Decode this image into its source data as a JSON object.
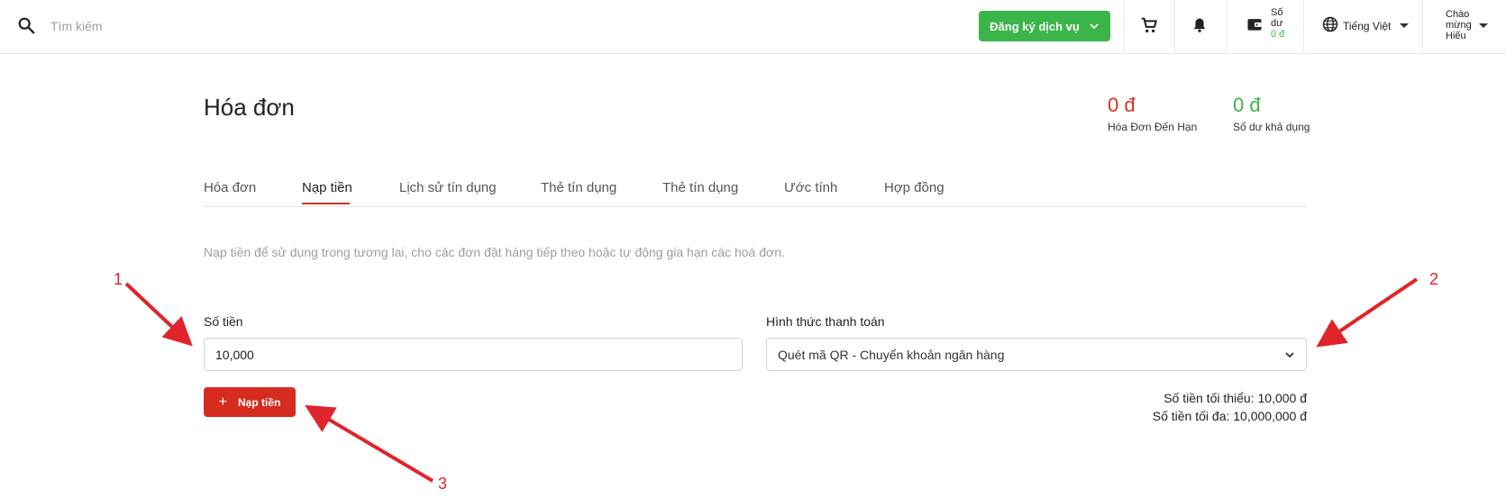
{
  "topbar": {
    "search_placeholder": "Tìm kiếm",
    "register_button": "Đăng ký dịch vụ",
    "balance_label_1": "Số",
    "balance_label_2": "dư",
    "balance_value": "0 đ",
    "language": "Tiếng Việt",
    "user_line1": "Chào",
    "user_line2": "mừng",
    "user_line3": "Hiếu",
    "icons": [
      "search-icon",
      "cart-icon",
      "bell-icon",
      "wallet-icon",
      "globe-icon"
    ]
  },
  "page": {
    "title": "Hóa đơn",
    "summary": [
      {
        "value": "0 đ",
        "label": "Hóa Đơn Đến Hạn",
        "color": "#d93025"
      },
      {
        "value": "0 đ",
        "label": "Số dư khả dụng",
        "color": "#3bb54a"
      }
    ],
    "tabs": [
      "Hóa đơn",
      "Nạp tiền",
      "Lịch sử tín dụng",
      "Thẻ tín dụng",
      "Thẻ tín dụng",
      "Ước tính",
      "Hợp đồng"
    ],
    "active_tab": "Nạp tiền",
    "description": "Nạp tiền để sử dụng trong tương lai, cho các đơn đặt hàng tiếp theo hoặc tự động gia hạn các hoá đơn.",
    "amount_label": "Số tiền",
    "amount_value": "10,000",
    "payment_label": "Hình thức thanh toán",
    "payment_selected": "Quét mã QR - Chuyển khoản ngân hàng",
    "topup_button": "Nạp tiền",
    "min_amount": "Số tiền tối thiểu: 10,000 đ",
    "max_amount": "Số tiền tối đa: 10,000,000 đ"
  },
  "annotations": [
    "1",
    "2",
    "3"
  ],
  "colors": {
    "accent_green": "#3bb54a",
    "accent_red": "#d93025",
    "annotation_red": "#e0242b"
  }
}
